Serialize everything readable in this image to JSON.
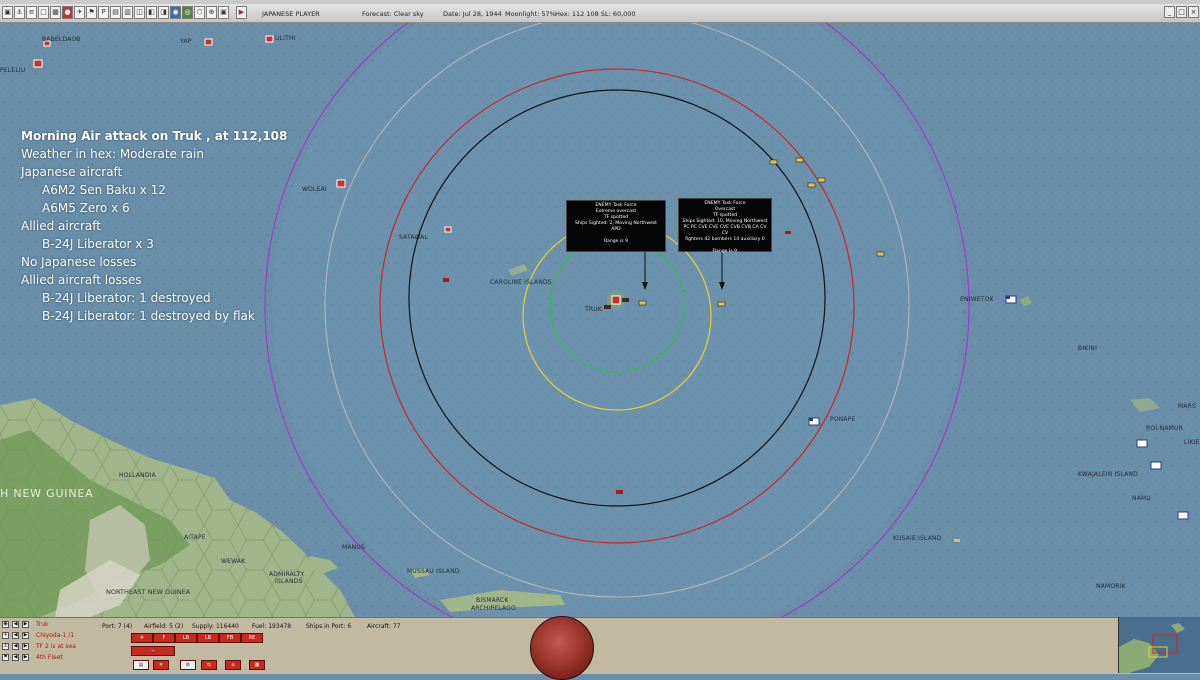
{
  "header": {
    "side": "JAPANESE PLAYER",
    "forecast": "Forecast: Clear sky",
    "date": "Date: Jul 28, 1944",
    "moonlight": "Moonlight: 57%",
    "hex": "Hex: 112 108  SL: 60,000"
  },
  "toolbar_icons": [
    "airfield-icon",
    "port-icon",
    "ship-icon",
    "unit-icon",
    "base-icon",
    "list-icon",
    "report-icon",
    "flag-icon",
    "plane-icon",
    "group-icon",
    "sub-icon",
    "mine-icon",
    "intel-icon",
    "prod-icon",
    "stop-icon",
    "globe-icon",
    "grid-icon",
    "hex-icon",
    "zoom-icon",
    "options-icon",
    "save-icon",
    "play-icon"
  ],
  "map_labels": {
    "babeldaob": "BABELDAOB",
    "yap": "YAP",
    "ulithi": "ULITHI",
    "peleliu": "PELELIU",
    "woleai": "WOLEAI",
    "satawal": "SATAWAL",
    "caroline": "CAROLINE ISLANDS",
    "truk": "TRUK",
    "eniwetok": "ENIWETOK",
    "bikini": "BIKINI",
    "ponape": "PONAPE",
    "roi_namur": "ROI-NAMUR",
    "kwajalein": "KWAJALEIN ISLAND",
    "namu": "NAMU",
    "likie": "LIKIE",
    "mars": "MARS",
    "hollandia": "HOLLANDIA",
    "new_guinea": "H NEW GUINEA",
    "aitape": "AITAPE",
    "wewak": "WEWAK",
    "manus": "MANUS",
    "admiralty": "ADMIRALTY",
    "islands": "ISLANDS",
    "ne_new_guinea": "NORTHEAST NEW GUINEA",
    "mussau": "MUSSAU ISLAND",
    "bismarck": "BISMARCK",
    "archipelago": "ARCHIPELAGO",
    "kusaie": "KUSAIE ISLAND",
    "namorik": "NAMORIK"
  },
  "combat_report": {
    "title": "Morning Air attack on Truk , at 112,108",
    "weather": "Weather in hex: Moderate rain",
    "japanese_heading": "Japanese aircraft",
    "japanese_aircraft": [
      "A6M2 Sen Baku x 12",
      "A6M5 Zero x 6"
    ],
    "allied_heading": "Allied aircraft",
    "allied_aircraft": [
      "B-24J Liberator x 3"
    ],
    "no_japanese_losses": "No Japanese losses",
    "allied_losses_heading": "Allied aircraft losses",
    "allied_losses": [
      "B-24J Liberator: 1 destroyed",
      "B-24J Liberator: 1 destroyed by flak"
    ]
  },
  "task_forces": [
    {
      "lines": [
        "ENEMY Task Force",
        "Extreme overcast",
        "TF spotted",
        "Ships Sighted: 2, Moving Northwest",
        "APD",
        "",
        "Range is 9"
      ]
    },
    {
      "lines": [
        "ENEMY Task Force",
        "Overcast",
        "TF spotted",
        "Ships Sighted: 10, Moving Northwest",
        "PC PC CVE CVE CVE CVB CVB CA CV CV",
        "fighters 42  bombers 14  auxiliary 0",
        "",
        "Range is 9"
      ]
    }
  ],
  "bottom_panel": {
    "rows": [
      {
        "label": "Truk"
      },
      {
        "label": "Chiyoda-1  /1"
      },
      {
        "label": "TF 2 is at sea"
      },
      {
        "label": "4th Fleet"
      }
    ],
    "port": "Port: 7 (4)",
    "airfield": "Airfield: 5 (2)",
    "supply": "Supply: 116440",
    "fuel": "Fuel: 193478",
    "ships_in_port": "Ships in Port: 6",
    "aircraft": "Aircraft: 77",
    "aircraft_buttons": [
      "F",
      "LB",
      "LB",
      "FB",
      "RE"
    ]
  },
  "colors": {
    "ocean": "#6a8ea8",
    "range_purple": "#9a3fc8",
    "range_red": "#c9262a",
    "range_black": "#111111",
    "range_yellow": "#e6d22a",
    "range_green": "#2fbf4a",
    "range_grey": "#b8b8b8",
    "japanese_base": "#c8302a",
    "allied_base": "#ffffff"
  }
}
